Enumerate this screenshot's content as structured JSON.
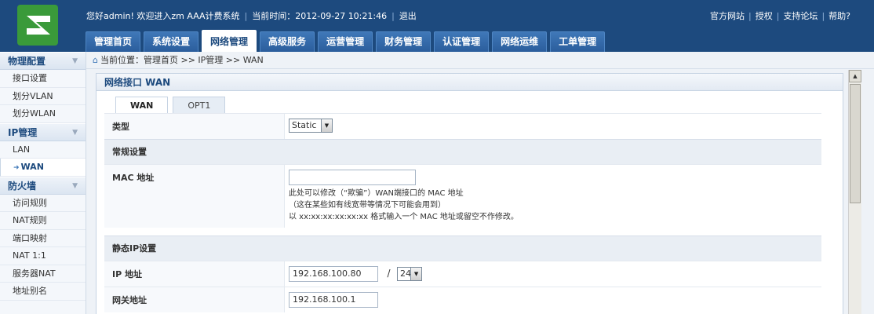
{
  "header": {
    "welcome": "您好admin! 欢迎进入zm AAA计费系统",
    "time_label": "当前时间：2012-09-27 10:21:46",
    "logout": "退出",
    "links": [
      "官方网站",
      "授权",
      "支持论坛",
      "帮助?"
    ],
    "brand_color": "#1d4a7e",
    "logo_color": "#3a9a3a"
  },
  "nav": {
    "tabs": [
      "管理首页",
      "系统设置",
      "网络管理",
      "高级服务",
      "运营管理",
      "财务管理",
      "认证管理",
      "网络运维",
      "工单管理"
    ],
    "active": "网络管理"
  },
  "sidebar": {
    "groups": [
      {
        "title": "物理配置",
        "items": [
          "接口设置",
          "划分VLAN",
          "划分WLAN"
        ]
      },
      {
        "title": "IP管理",
        "items": [
          "LAN",
          "WAN"
        ]
      },
      {
        "title": "防火墙",
        "items": [
          "访问规则",
          "NAT规则",
          "端口映射",
          "NAT 1:1",
          "服务器NAT",
          "地址别名"
        ]
      }
    ],
    "active_item": "WAN"
  },
  "breadcrumb": {
    "text": "当前位置：管理首页 >> IP管理 >> WAN"
  },
  "panel": {
    "title": "网络接口 WAN",
    "tabs": [
      "WAN",
      "OPT1"
    ],
    "active_tab": "WAN",
    "type_label": "类型",
    "type_value": "Static",
    "general_section": "常规设置",
    "mac_label": "MAC 地址",
    "mac_value": "",
    "mac_help": [
      "此处可以修改（“欺骗”）WAN端接口的 MAC 地址",
      "（这在某些如有线宽带等情况下可能会用到）",
      "以 xx:xx:xx:xx:xx:xx 格式输入一个 MAC 地址或留空不作修改。"
    ],
    "static_section": "静态IP设置",
    "ip_label": "IP 地址",
    "ip_value": "192.168.100.80",
    "mask_value": "24",
    "gateway_label": "网关地址",
    "gateway_value": "192.168.100.1"
  }
}
